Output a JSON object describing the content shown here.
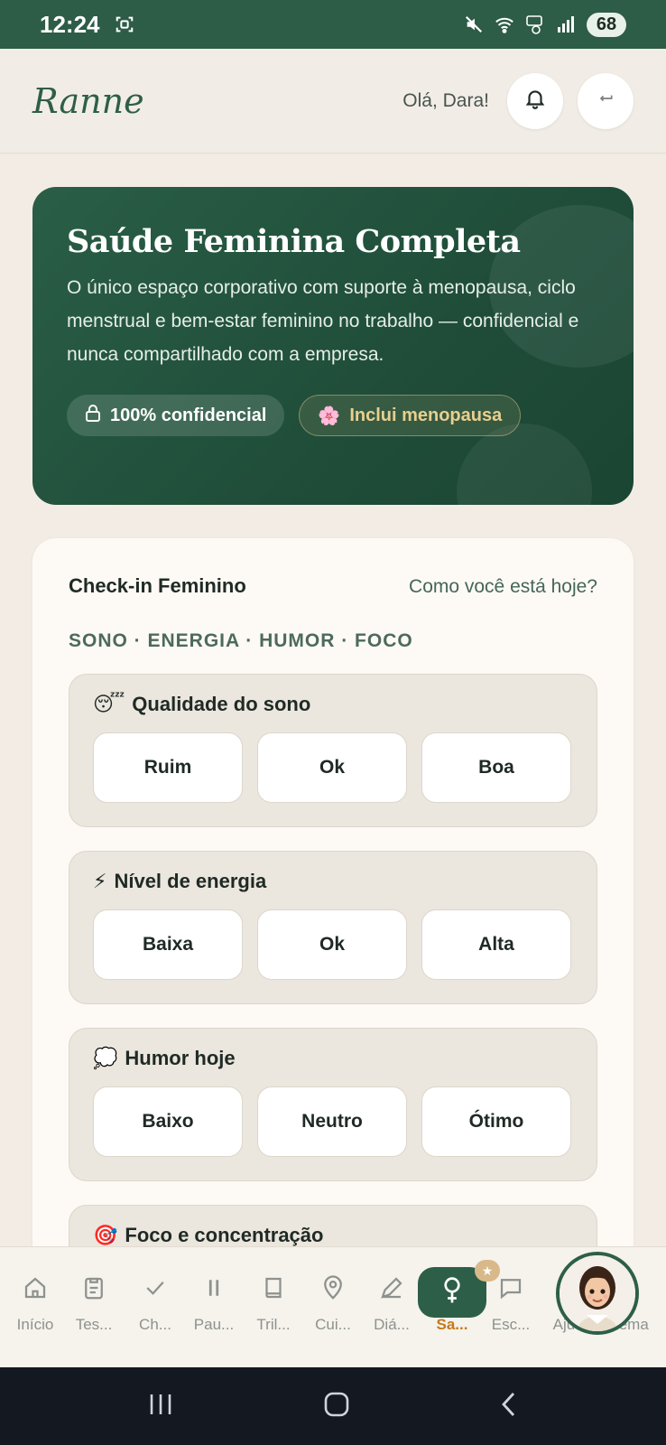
{
  "status_bar": {
    "time": "12:24",
    "battery": "68"
  },
  "header": {
    "brand": "Ranne",
    "greeting": "Olá, Dara!"
  },
  "hero": {
    "title": "Saúde Feminina Completa",
    "description": "O único espaço corporativo com suporte à menopausa, ciclo menstrual e bem-estar feminino no trabalho — confidencial e nunca compartilhado com a empresa.",
    "chip_confidential": "100% confidencial",
    "chip_menopause": "Inclui menopausa"
  },
  "checkin": {
    "title": "Check-in Feminino",
    "subtitle": "Como você está hoje?",
    "tags": "SONO · ENERGIA · HUMOR · FOCO",
    "questions": [
      {
        "emoji": "😴",
        "label": "Qualidade do sono",
        "options": [
          "Ruim",
          "Ok",
          "Boa"
        ]
      },
      {
        "emoji": "⚡",
        "label": "Nível de energia",
        "options": [
          "Baixa",
          "Ok",
          "Alta"
        ]
      },
      {
        "emoji": "💭",
        "label": "Humor hoje",
        "options": [
          "Baixo",
          "Neutro",
          "Ótimo"
        ]
      },
      {
        "emoji": "🎯",
        "label": "Foco e concentração",
        "options": []
      }
    ]
  },
  "bottom_nav": {
    "items": [
      {
        "label": "Início",
        "icon": "home-icon"
      },
      {
        "label": "Tes...",
        "icon": "clipboard-icon"
      },
      {
        "label": "Ch...",
        "icon": "check-icon"
      },
      {
        "label": "Pau...",
        "icon": "pause-icon"
      },
      {
        "label": "Tril...",
        "icon": "book-icon"
      },
      {
        "label": "Cui...",
        "icon": "map-pin-icon"
      },
      {
        "label": "Diá...",
        "icon": "pencil-icon"
      },
      {
        "label": "Sa...",
        "icon": "female-symbol-icon",
        "active": true
      },
      {
        "label": "Esc...",
        "icon": "chat-icon"
      },
      {
        "label": "Aju...",
        "icon": "help-icon"
      },
      {
        "label": "Tema",
        "icon": "theme-icon"
      }
    ]
  },
  "colors": {
    "primary": "#2d5c47",
    "active_label": "#c27a18",
    "background": "#f2ece4",
    "chip_gold": "#e8cf8f"
  }
}
